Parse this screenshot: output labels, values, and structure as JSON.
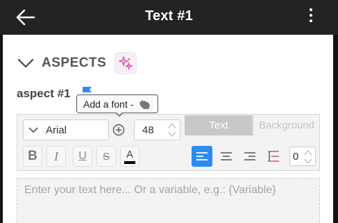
{
  "header": {
    "title": "Text #1"
  },
  "section": {
    "title": "ASPECTS",
    "aspect_label": "aspect #1"
  },
  "tooltip": {
    "text": "Add a font -"
  },
  "font": {
    "name": "Arial",
    "size": "48"
  },
  "tabs": [
    {
      "label": "Text"
    },
    {
      "label": "Background"
    }
  ],
  "format": {
    "bold": "B",
    "italic": "I",
    "underline": "U",
    "strike": "S",
    "color": "A"
  },
  "line_height": "0",
  "editor": {
    "placeholder": "Enter your text here... Or a variable, e.g.: {Variable}"
  },
  "colors": {
    "accent": "#2d8cf0",
    "header": "#232323",
    "sparkle": "#e33fb8",
    "flag": "#2d8cf0"
  }
}
